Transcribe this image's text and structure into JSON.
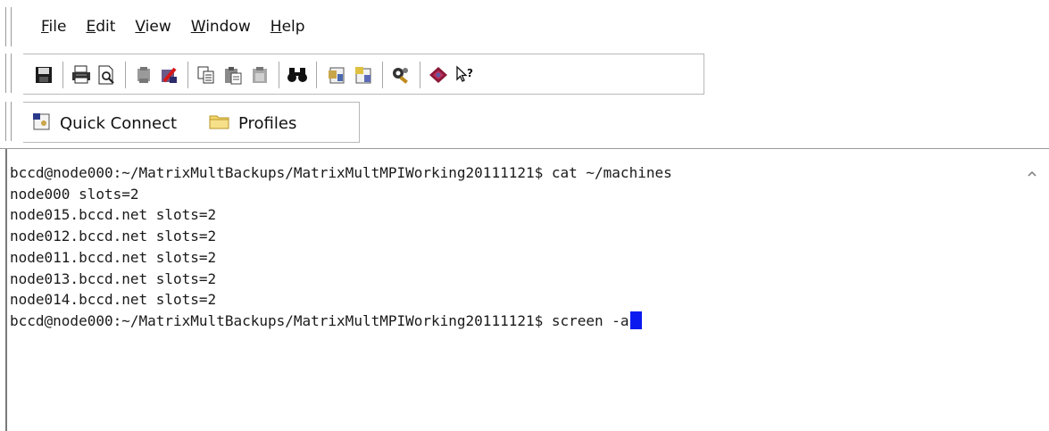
{
  "menu": {
    "items": [
      {
        "label_u": "F",
        "label_rest": "ile"
      },
      {
        "label_u": "E",
        "label_rest": "dit"
      },
      {
        "label_u": "V",
        "label_rest": "iew"
      },
      {
        "label_u": "W",
        "label_rest": "indow"
      },
      {
        "label_u": "H",
        "label_rest": "elp"
      }
    ]
  },
  "toolbar": {
    "icons": [
      "save-icon",
      "print-icon",
      "print-preview-icon",
      "disconnect-icon",
      "delete-profile-icon",
      "copy-icon",
      "paste-icon",
      "paste-disabled-icon",
      "find-icon",
      "settings-icon",
      "profile-settings-icon",
      "key-manager-icon",
      "help-book-icon",
      "whats-this-icon"
    ]
  },
  "connectbar": {
    "quick_connect_label": "Quick Connect",
    "profiles_label": "Profiles"
  },
  "terminal": {
    "lines": [
      "bccd@node000:~/MatrixMultBackups/MatrixMultMPIWorking20111121$ cat ~/machines",
      "node000 slots=2",
      "node015.bccd.net slots=2",
      "node012.bccd.net slots=2",
      "node011.bccd.net slots=2",
      "node013.bccd.net slots=2",
      "node014.bccd.net slots=2"
    ],
    "prompt_line": "bccd@node000:~/MatrixMultBackups/MatrixMultMPIWorking20111121$ screen -a"
  },
  "colors": {
    "cursor": "#0b1bf0",
    "background": "#ffffff"
  }
}
